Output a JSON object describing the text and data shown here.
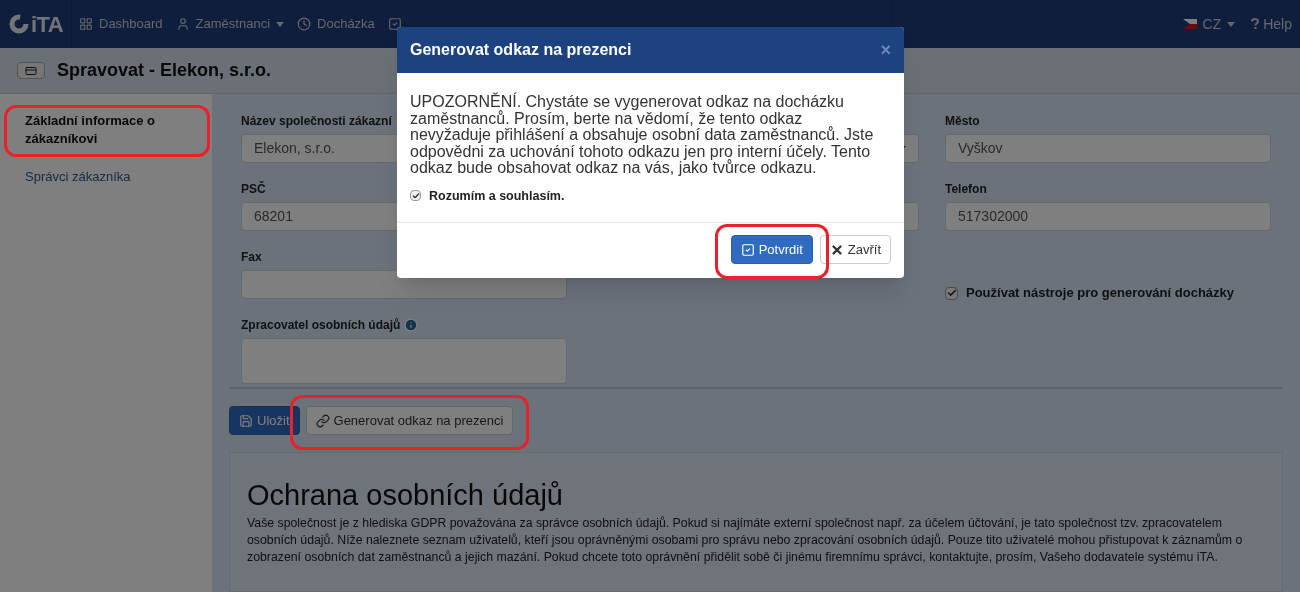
{
  "navbar": {
    "logo": "iTA",
    "items": [
      {
        "label": "Dashboard",
        "dropdown": false
      },
      {
        "label": "Zaměstnanci",
        "dropdown": true
      },
      {
        "label": "Docházka",
        "dropdown": false
      }
    ],
    "language": "CZ",
    "help": "Help"
  },
  "page_header": {
    "title": "Spravovat - Elekon, s.r.o."
  },
  "sidebar": {
    "items": [
      {
        "label": "Základní informace o zákazníkovi",
        "selected": true,
        "highlighted": true
      },
      {
        "label": "Správci zákazníka",
        "selected": false,
        "highlighted": false
      }
    ]
  },
  "form": {
    "columns": [
      {
        "fields": [
          {
            "kind": "input",
            "label": "Název společnosti zákazní",
            "value": "Elekon, s.r.o."
          },
          {
            "kind": "input",
            "label": "PSČ",
            "value": "68201"
          },
          {
            "kind": "input",
            "label": "Fax"
          },
          {
            "kind": "textarea",
            "label": "Zpracovatel osobních údajů",
            "info": true
          }
        ]
      },
      {
        "fields": [
          {
            "kind": "select"
          },
          {
            "kind": "input"
          }
        ]
      },
      {
        "fields": [
          {
            "kind": "input",
            "label": "Město",
            "value": "Vyškov"
          },
          {
            "kind": "input",
            "label": "Telefon",
            "value": "517302000"
          },
          {
            "kind": "checkbox",
            "label": "Používat nástroje pro generování docházky",
            "checked": true
          }
        ]
      }
    ]
  },
  "actions": [
    {
      "label": "Uložit",
      "kind": "primary",
      "highlighted": false
    },
    {
      "label": "Generovat odkaz na prezenci",
      "kind": "default",
      "highlighted": true
    }
  ],
  "privacy": {
    "heading": "Ochrana osobních údajů",
    "text": "Vaše společnost je z hlediska GDPR považována za správce osobních údajů. Pokud si najímáte externí společnost např. za účelem účtování, je tato společnost tzv. zpracovatelem osobních údajů. Níže naleznete seznam uživatelů, kteří jsou oprávněnými osobami pro správu nebo zpracování osobních údajů. Pouze tito uživatelé mohou přistupovat k záznamům o zobrazení osobních dat zaměstnanců a jejich mazání. Pokud chcete toto oprávnění přidělit sobě či jinému firemnímu správci, kontaktujte, prosím, Vašeho dodavatele systému iTA."
  },
  "modal": {
    "title": "Generovat odkaz na prezenci",
    "close": "×",
    "message": "UPOZORNĚNÍ. Chystáte se vygenerovat odkaz na docházku zaměstnanců. Prosím, berte na vědomí, že tento odkaz nevyžaduje přihlášení a obsahuje osobní data zaměstnanců. Jste odpovědni za uchování tohoto odkazu jen pro interní účely. Tento odkaz bude obsahovat odkaz na vás, jako tvůrce odkazu.",
    "checkbox": {
      "label": "Rozumím a souhlasím.",
      "checked": true
    },
    "buttons": [
      {
        "label": "Potvrdit",
        "kind": "primary",
        "highlighted": true
      },
      {
        "label": "Zavřít",
        "kind": "default",
        "highlighted": false
      }
    ]
  }
}
